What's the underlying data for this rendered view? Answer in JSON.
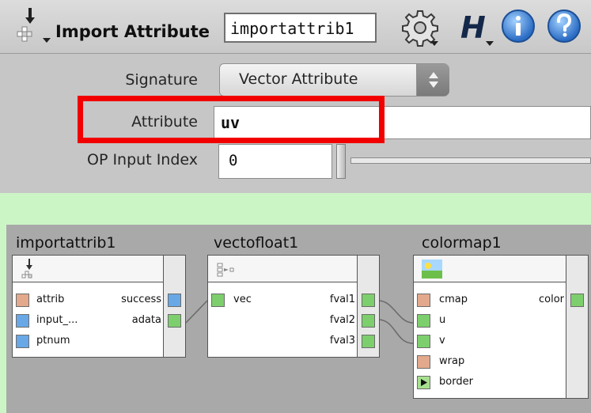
{
  "header": {
    "node_type_label": "Import Attribute",
    "node_name": "importattrib1",
    "help_letter": "H"
  },
  "params": {
    "signature_label": "Signature",
    "signature_value": "Vector Attribute",
    "attribute_label": "Attribute",
    "attribute_value": "uv",
    "op_input_index_label": "OP Input Index",
    "op_input_index_value": "0"
  },
  "network": {
    "nodes": [
      {
        "title": "importattrib1",
        "inputs": [
          "attrib",
          "input_...",
          "ptnum"
        ],
        "outputs": [
          "success",
          "adata"
        ]
      },
      {
        "title": "vectofloat1",
        "inputs": [
          "vec"
        ],
        "outputs": [
          "fval1",
          "fval2",
          "fval3"
        ]
      },
      {
        "title": "colormap1",
        "inputs": [
          "cmap",
          "u",
          "v",
          "wrap",
          "border"
        ],
        "outputs": [
          "color"
        ]
      }
    ]
  },
  "colors": {
    "highlight": "#f20000",
    "background": "#ccf5c6",
    "network_bg": "#a9a9a9"
  },
  "icons": [
    "import-node-icon",
    "gear-icon",
    "houdini-h-icon",
    "info-icon",
    "help-icon",
    "vectofloat-node-icon",
    "colormap-node-icon"
  ]
}
